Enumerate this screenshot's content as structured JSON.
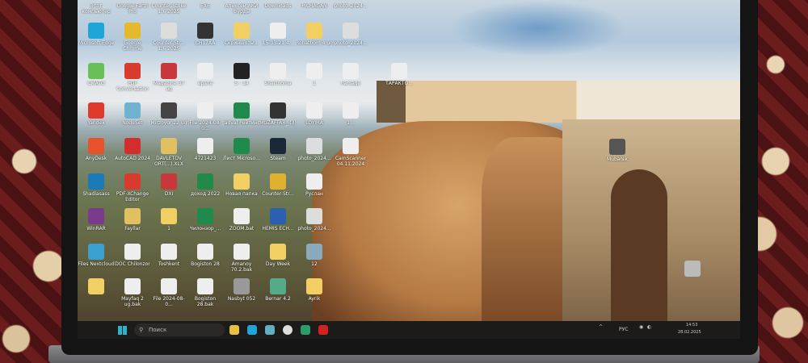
{
  "desktop": {
    "top_row_labels": [
      "Этот компьютер",
      "Google Earth Pro",
      "Counter-Strike 1.6 2025",
      "EXE",
      "Алексей АКИ Фурды",
      "Downloads",
      "PICHAGAN",
      "photo_2024..."
    ],
    "rows": [
      [
        {
          "label": "Microsoft Edge",
          "color": "#1fa6d8"
        },
        {
          "label": "Google Chrome",
          "color": "#e5b92c"
        },
        {
          "label": "Counter-Str... 1.6 2025",
          "color": "#ddd"
        },
        {
          "label": "CH17AA",
          "color": "#333"
        },
        {
          "label": "Скриншоты...",
          "color": "#f1cf63"
        },
        {
          "label": "15-03-21 4...",
          "color": "#eee"
        },
        {
          "label": "Rohatbom 4 ug",
          "color": "#f1cf63"
        },
        {
          "label": "photo_2024...",
          "color": "#ddd"
        }
      ],
      [
        {
          "label": "CMATO",
          "color": "#6bbf59"
        },
        {
          "label": "PDF Conversation",
          "color": "#d83a2e"
        },
        {
          "label": "Magazine 37 ug",
          "color": "#c8373a"
        },
        {
          "label": "ерате",
          "color": "#eee"
        },
        {
          "label": "5 - 14",
          "color": "#222"
        },
        {
          "label": "Shartnoma",
          "color": "#eee"
        },
        {
          "label": "1",
          "color": "#eee"
        },
        {
          "label": "narsage",
          "color": "#eee"
        }
      ],
      [
        {
          "label": "Yandex",
          "color": "#e03a2c"
        },
        {
          "label": "NodeSet",
          "color": "#6fb3d0"
        },
        {
          "label": "Mirzoyor 22 ug",
          "color": "#444"
        },
        {
          "label": "File 2024-08-0...",
          "color": "#eee"
        },
        {
          "label": "Jadval Рейтинг",
          "color": "#1f8a4c"
        },
        {
          "label": "MUZAFFAR_ (3)",
          "color": "#333"
        },
        {
          "label": "LOYIHA",
          "color": "#eee"
        },
        {
          "label": "1...",
          "color": "#eee"
        }
      ],
      [
        {
          "label": "AnyDesk",
          "color": "#e8522c"
        },
        {
          "label": "AutoCAD 2024",
          "color": "#d42d2d"
        },
        {
          "label": "DAVLETOV ORT(...).XLX",
          "color": "#e0c060"
        },
        {
          "label": "4721423",
          "color": "#eee"
        },
        {
          "label": "Лист Microso...",
          "color": "#1f8a4c"
        },
        {
          "label": "Steam",
          "color": "#1b2838"
        },
        {
          "label": "photo_2024...",
          "color": "#ddd"
        },
        {
          "label": "CamScanner 04.11.2024",
          "color": "#eee"
        }
      ],
      [
        {
          "label": "Shadiasass",
          "color": "#1a7ab8"
        },
        {
          "label": "PDF-XChange Editor",
          "color": "#d83a2e"
        },
        {
          "label": "DXI",
          "color": "#c8373a"
        },
        {
          "label": "доход 2022",
          "color": "#1f8a4c"
        },
        {
          "label": "Новая папка",
          "color": "#f1cf63"
        },
        {
          "label": "Counter-Str...",
          "color": "#e0b030"
        },
        {
          "label": "Руслан",
          "color": "#eee"
        }
      ],
      [
        {
          "label": "WinRAR",
          "color": "#7a3b8c"
        },
        {
          "label": "Fayllar",
          "color": "#e0c060"
        },
        {
          "label": "1",
          "color": "#f1cf63"
        },
        {
          "label": "Чилонзор_...",
          "color": "#1f8a4c"
        },
        {
          "label": "ZOOM.bat",
          "color": "#eee"
        },
        {
          "label": "HEMIS ECH...",
          "color": "#2b5fb0"
        },
        {
          "label": "photo_2024...",
          "color": "#ddd"
        }
      ],
      [
        {
          "label": "Files Nextcloud",
          "color": "#3aa0d0"
        },
        {
          "label": "DOC Chilonzor",
          "color": "#eee"
        },
        {
          "label": "Toshkent",
          "color": "#eee"
        },
        {
          "label": "Bogiston 28",
          "color": "#eee"
        },
        {
          "label": "Amanoy 70.2.bak",
          "color": "#eee"
        },
        {
          "label": "Day Week",
          "color": "#f1cf63"
        },
        {
          "label": "12",
          "color": "#8ab"
        }
      ],
      [
        {
          "label": "",
          "color": "#f1cf63"
        },
        {
          "label": "Mayfaq 2 ug.bak",
          "color": "#eee"
        },
        {
          "label": "File 2024-08-0...",
          "color": "#eee"
        },
        {
          "label": "Bogiston 28.bak",
          "color": "#eee"
        },
        {
          "label": "Nasbyt 052",
          "color": "#999"
        },
        {
          "label": "Bernar 4.2",
          "color": "#5a8"
        },
        {
          "label": "Ayrik",
          "color": "#f1cf63"
        }
      ]
    ],
    "extra": [
      {
        "label": "ТАРАКТО...",
        "color": "#eee"
      },
      {
        "label": "Mubarek",
        "color": "#555"
      },
      {
        "label": "",
        "color": "#bbb"
      }
    ]
  },
  "taskbar": {
    "search_placeholder": "Поиск",
    "lang": "РУС",
    "time": "14:53",
    "date": "28.02.2025",
    "apps": [
      {
        "name": "file-explorer",
        "color": "#e8c040"
      },
      {
        "name": "edge",
        "color": "#1fa6d8"
      },
      {
        "name": "files",
        "color": "#5fb0c0"
      },
      {
        "name": "yandex-browser",
        "color": "#ddd"
      },
      {
        "name": "telegram-chrome",
        "color": "#2a9d6a"
      },
      {
        "name": "youtube",
        "color": "#d42020"
      }
    ]
  }
}
